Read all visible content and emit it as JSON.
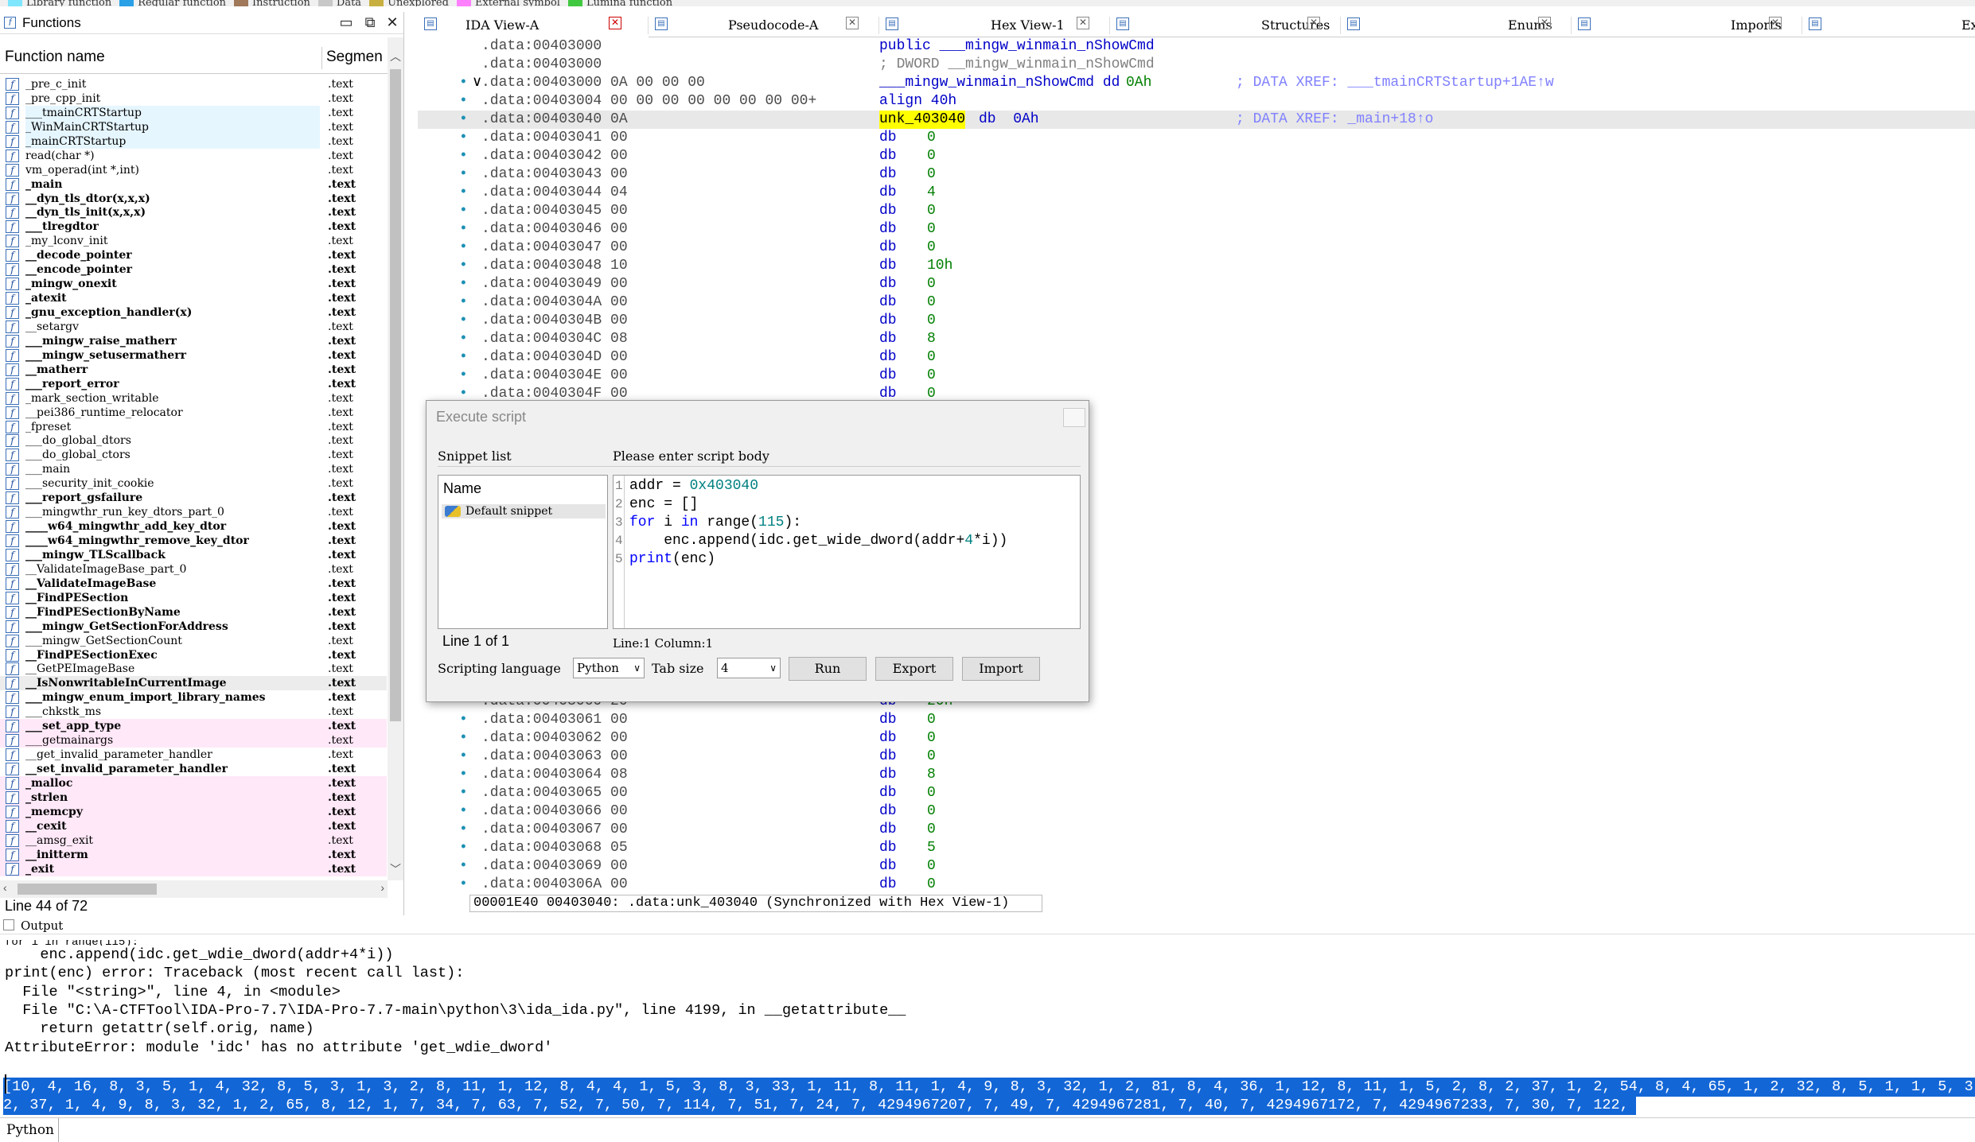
{
  "legend": [
    {
      "label": "Library function",
      "color": "#7fe6ff"
    },
    {
      "label": "Regular function",
      "color": "#2aa0e6"
    },
    {
      "label": "Instruction",
      "color": "#a0785a"
    },
    {
      "label": "Data",
      "color": "#c8c8c8"
    },
    {
      "label": "Unexplored",
      "color": "#c8b040"
    },
    {
      "label": "External symbol",
      "color": "#ff80ff"
    },
    {
      "label": "Lumina function",
      "color": "#40c840"
    }
  ],
  "functions": {
    "title": "Functions",
    "col_name": "Function name",
    "col_segment": "Segmen",
    "status": "Line 44 of 72",
    "rows": [
      {
        "name": "_pre_c_init",
        "seg": ".text",
        "bold": false,
        "lib": false,
        "pink": false
      },
      {
        "name": "_pre_cpp_init",
        "seg": ".text",
        "bold": false,
        "lib": false,
        "pink": false
      },
      {
        "name": "___tmainCRTStartup",
        "seg": ".text",
        "bold": false,
        "lib": true,
        "pink": false
      },
      {
        "name": "_WinMainCRTStartup",
        "seg": ".text",
        "bold": false,
        "lib": true,
        "pink": false
      },
      {
        "name": "_mainCRTStartup",
        "seg": ".text",
        "bold": false,
        "lib": true,
        "pink": false
      },
      {
        "name": "read(char *)",
        "seg": ".text",
        "bold": false,
        "lib": false,
        "pink": false
      },
      {
        "name": "vm_operad(int *,int)",
        "seg": ".text",
        "bold": false,
        "lib": false,
        "pink": false
      },
      {
        "name": "_main",
        "seg": ".text",
        "bold": true,
        "lib": false,
        "pink": false
      },
      {
        "name": "__dyn_tls_dtor(x,x,x)",
        "seg": ".text",
        "bold": true,
        "lib": false,
        "pink": false
      },
      {
        "name": "__dyn_tls_init(x,x,x)",
        "seg": ".text",
        "bold": true,
        "lib": false,
        "pink": false
      },
      {
        "name": "___tlregdtor",
        "seg": ".text",
        "bold": true,
        "lib": false,
        "pink": false
      },
      {
        "name": "_my_lconv_init",
        "seg": ".text",
        "bold": false,
        "lib": false,
        "pink": false
      },
      {
        "name": "__decode_pointer",
        "seg": ".text",
        "bold": true,
        "lib": false,
        "pink": false
      },
      {
        "name": "__encode_pointer",
        "seg": ".text",
        "bold": true,
        "lib": false,
        "pink": false
      },
      {
        "name": "_mingw_onexit",
        "seg": ".text",
        "bold": true,
        "lib": false,
        "pink": false
      },
      {
        "name": "_atexit",
        "seg": ".text",
        "bold": true,
        "lib": false,
        "pink": false
      },
      {
        "name": "_gnu_exception_handler(x)",
        "seg": ".text",
        "bold": true,
        "lib": false,
        "pink": false
      },
      {
        "name": "__setargv",
        "seg": ".text",
        "bold": false,
        "lib": false,
        "pink": false
      },
      {
        "name": "___mingw_raise_matherr",
        "seg": ".text",
        "bold": true,
        "lib": false,
        "pink": false
      },
      {
        "name": "___mingw_setusermatherr",
        "seg": ".text",
        "bold": true,
        "lib": false,
        "pink": false
      },
      {
        "name": "__matherr",
        "seg": ".text",
        "bold": true,
        "lib": false,
        "pink": false
      },
      {
        "name": "___report_error",
        "seg": ".text",
        "bold": true,
        "lib": false,
        "pink": false
      },
      {
        "name": "_mark_section_writable",
        "seg": ".text",
        "bold": false,
        "lib": false,
        "pink": false
      },
      {
        "name": "__pei386_runtime_relocator",
        "seg": ".text",
        "bold": false,
        "lib": false,
        "pink": false
      },
      {
        "name": "_fpreset",
        "seg": ".text",
        "bold": false,
        "lib": false,
        "pink": false
      },
      {
        "name": "___do_global_dtors",
        "seg": ".text",
        "bold": false,
        "lib": false,
        "pink": false
      },
      {
        "name": "___do_global_ctors",
        "seg": ".text",
        "bold": false,
        "lib": false,
        "pink": false
      },
      {
        "name": "___main",
        "seg": ".text",
        "bold": false,
        "lib": false,
        "pink": false
      },
      {
        "name": "___security_init_cookie",
        "seg": ".text",
        "bold": false,
        "lib": false,
        "pink": false
      },
      {
        "name": "___report_gsfailure",
        "seg": ".text",
        "bold": true,
        "lib": false,
        "pink": false
      },
      {
        "name": "___mingwthr_run_key_dtors_part_0",
        "seg": ".text",
        "bold": false,
        "lib": false,
        "pink": false
      },
      {
        "name": "____w64_mingwthr_add_key_dtor",
        "seg": ".text",
        "bold": true,
        "lib": false,
        "pink": false
      },
      {
        "name": "____w64_mingwthr_remove_key_dtor",
        "seg": ".text",
        "bold": true,
        "lib": false,
        "pink": false
      },
      {
        "name": "___mingw_TLScallback",
        "seg": ".text",
        "bold": true,
        "lib": false,
        "pink": false
      },
      {
        "name": "__ValidateImageBase_part_0",
        "seg": ".text",
        "bold": false,
        "lib": false,
        "pink": false
      },
      {
        "name": "__ValidateImageBase",
        "seg": ".text",
        "bold": true,
        "lib": false,
        "pink": false
      },
      {
        "name": "__FindPESection",
        "seg": ".text",
        "bold": true,
        "lib": false,
        "pink": false
      },
      {
        "name": "__FindPESectionByName",
        "seg": ".text",
        "bold": true,
        "lib": false,
        "pink": false
      },
      {
        "name": "___mingw_GetSectionForAddress",
        "seg": ".text",
        "bold": true,
        "lib": false,
        "pink": false
      },
      {
        "name": "___mingw_GetSectionCount",
        "seg": ".text",
        "bold": false,
        "lib": false,
        "pink": false
      },
      {
        "name": "__FindPESectionExec",
        "seg": ".text",
        "bold": true,
        "lib": false,
        "pink": false
      },
      {
        "name": "__GetPEImageBase",
        "seg": ".text",
        "bold": false,
        "lib": false,
        "pink": false
      },
      {
        "name": "__IsNonwritableInCurrentImage",
        "seg": ".text",
        "bold": true,
        "lib": false,
        "pink": false,
        "sel": true
      },
      {
        "name": "___mingw_enum_import_library_names",
        "seg": ".text",
        "bold": true,
        "lib": false,
        "pink": false
      },
      {
        "name": "___chkstk_ms",
        "seg": ".text",
        "bold": false,
        "lib": false,
        "pink": false
      },
      {
        "name": "___set_app_type",
        "seg": ".text",
        "bold": true,
        "lib": false,
        "pink": true
      },
      {
        "name": "___getmainargs",
        "seg": ".text",
        "bold": false,
        "lib": false,
        "pink": true
      },
      {
        "name": "__get_invalid_parameter_handler",
        "seg": ".text",
        "bold": false,
        "lib": false,
        "pink": false
      },
      {
        "name": "__set_invalid_parameter_handler",
        "seg": ".text",
        "bold": true,
        "lib": false,
        "pink": false
      },
      {
        "name": "_malloc",
        "seg": ".text",
        "bold": true,
        "lib": false,
        "pink": true
      },
      {
        "name": "_strlen",
        "seg": ".text",
        "bold": true,
        "lib": false,
        "pink": true
      },
      {
        "name": "_memcpy",
        "seg": ".text",
        "bold": true,
        "lib": false,
        "pink": true
      },
      {
        "name": "__cexit",
        "seg": ".text",
        "bold": true,
        "lib": false,
        "pink": true
      },
      {
        "name": "__amsg_exit",
        "seg": ".text",
        "bold": false,
        "lib": false,
        "pink": true
      },
      {
        "name": "__initterm",
        "seg": ".text",
        "bold": true,
        "lib": false,
        "pink": true
      },
      {
        "name": "_exit",
        "seg": ".text",
        "bold": true,
        "lib": false,
        "pink": true
      }
    ]
  },
  "tabs": [
    {
      "label": "IDA View-A",
      "icon": "ida-icon",
      "active": true
    },
    {
      "label": "Pseudocode-A",
      "icon": "pseudocode-icon",
      "active": false
    },
    {
      "label": "Hex View-1",
      "icon": "hex-icon",
      "active": false
    },
    {
      "label": "Structures",
      "icon": "structures-icon",
      "active": false
    },
    {
      "label": "Enums",
      "icon": "enums-icon",
      "active": false
    },
    {
      "label": "Imports",
      "icon": "imports-icon",
      "active": false
    },
    {
      "label": "Exports",
      "icon": "exports-icon",
      "active": false
    }
  ],
  "disasm_top": [
    {
      "dot": "",
      "addr": ".data:00403000",
      "bytes": "",
      "ins": "public ___mingw_winmain_nShowCmd",
      "opr": "",
      "cmt": "",
      "style": "plain"
    },
    {
      "dot": "",
      "addr": ".data:00403000",
      "bytes": "",
      "ins": "; DWORD __mingw_winmain_nShowCmd",
      "opr": "",
      "cmt": "",
      "style": "grayins"
    },
    {
      "dot": "•",
      "addr": ".data:00403000 0A 00 00 00",
      "bytes": "",
      "ins": "___mingw_winmain_nShowCmd dd ",
      "opr": "0Ah",
      "cmt": "; DATA XREF: ___tmainCRTStartup+1AE↑w",
      "style": "plain"
    },
    {
      "dot": "•",
      "addr": ".data:00403004 00 00 00 00 00 00 00 00+",
      "bytes": "",
      "ins": "align 40h",
      "opr": "",
      "cmt": "",
      "style": "plain"
    },
    {
      "dot": "•",
      "addr": ".data:00403040 0A",
      "bytes": "",
      "ins": "unk_403040",
      "opr": "db  0Ah",
      "cmt": "; DATA XREF: _main+18↑o",
      "style": "label"
    },
    {
      "dot": "•",
      "addr": ".data:00403041 00",
      "bytes": "",
      "ins": "db",
      "opr": "0",
      "cmt": "",
      "style": "db"
    },
    {
      "dot": "•",
      "addr": ".data:00403042 00",
      "bytes": "",
      "ins": "db",
      "opr": "0",
      "cmt": "",
      "style": "db"
    },
    {
      "dot": "•",
      "addr": ".data:00403043 00",
      "bytes": "",
      "ins": "db",
      "opr": "0",
      "cmt": "",
      "style": "db"
    },
    {
      "dot": "•",
      "addr": ".data:00403044 04",
      "bytes": "",
      "ins": "db",
      "opr": "4",
      "cmt": "",
      "style": "db"
    },
    {
      "dot": "•",
      "addr": ".data:00403045 00",
      "bytes": "",
      "ins": "db",
      "opr": "0",
      "cmt": "",
      "style": "db"
    },
    {
      "dot": "•",
      "addr": ".data:00403046 00",
      "bytes": "",
      "ins": "db",
      "opr": "0",
      "cmt": "",
      "style": "db"
    },
    {
      "dot": "•",
      "addr": ".data:00403047 00",
      "bytes": "",
      "ins": "db",
      "opr": "0",
      "cmt": "",
      "style": "db"
    },
    {
      "dot": "•",
      "addr": ".data:00403048 10",
      "bytes": "",
      "ins": "db",
      "opr": "10h",
      "cmt": "",
      "style": "db"
    },
    {
      "dot": "•",
      "addr": ".data:00403049 00",
      "bytes": "",
      "ins": "db",
      "opr": "0",
      "cmt": "",
      "style": "db"
    },
    {
      "dot": "•",
      "addr": ".data:0040304A 00",
      "bytes": "",
      "ins": "db",
      "opr": "0",
      "cmt": "",
      "style": "db"
    },
    {
      "dot": "•",
      "addr": ".data:0040304B 00",
      "bytes": "",
      "ins": "db",
      "opr": "0",
      "cmt": "",
      "style": "db"
    },
    {
      "dot": "•",
      "addr": ".data:0040304C 08",
      "bytes": "",
      "ins": "db",
      "opr": "8",
      "cmt": "",
      "style": "db"
    },
    {
      "dot": "•",
      "addr": ".data:0040304D 00",
      "bytes": "",
      "ins": "db",
      "opr": "0",
      "cmt": "",
      "style": "db"
    },
    {
      "dot": "•",
      "addr": ".data:0040304E 00",
      "bytes": "",
      "ins": "db",
      "opr": "0",
      "cmt": "",
      "style": "db"
    },
    {
      "dot": "•",
      "addr": ".data:0040304F 00",
      "bytes": "",
      "ins": "db",
      "opr": "0",
      "cmt": "",
      "style": "db"
    }
  ],
  "disasm_bottom": [
    {
      "dot": "•",
      "addr": ".data:00403060 20",
      "ins": "db",
      "opr": "20h"
    },
    {
      "dot": "•",
      "addr": ".data:00403061 00",
      "ins": "db",
      "opr": "0"
    },
    {
      "dot": "•",
      "addr": ".data:00403062 00",
      "ins": "db",
      "opr": "0"
    },
    {
      "dot": "•",
      "addr": ".data:00403063 00",
      "ins": "db",
      "opr": "0"
    },
    {
      "dot": "•",
      "addr": ".data:00403064 08",
      "ins": "db",
      "opr": "8"
    },
    {
      "dot": "•",
      "addr": ".data:00403065 00",
      "ins": "db",
      "opr": "0"
    },
    {
      "dot": "•",
      "addr": ".data:00403066 00",
      "ins": "db",
      "opr": "0"
    },
    {
      "dot": "•",
      "addr": ".data:00403067 00",
      "ins": "db",
      "opr": "0"
    },
    {
      "dot": "•",
      "addr": ".data:00403068 05",
      "ins": "db",
      "opr": "5"
    },
    {
      "dot": "•",
      "addr": ".data:00403069 00",
      "ins": "db",
      "opr": "0"
    },
    {
      "dot": "•",
      "addr": ".data:0040306A 00",
      "ins": "db",
      "opr": "0"
    }
  ],
  "hex_status": "00001E40 00403040: .data:unk_403040 (Synchronized with Hex View-1)",
  "dialog": {
    "title": "Execute script",
    "snippet_list_label": "Snippet list",
    "script_body_label": "Please enter script body",
    "snippets_header": "Name",
    "snippet_item": "Default snippet",
    "line_of": "Line 1 of 1",
    "cursor_pos": "Line:1   Column:1",
    "scripting_language_label": "Scripting language",
    "scripting_language": "Python",
    "tab_size_label": "Tab size",
    "tab_size": "4",
    "run": "Run",
    "export": "Export",
    "import": "Import",
    "code": [
      [
        {
          "t": "addr = ",
          "c": ""
        },
        {
          "t": "0x403040",
          "c": "num"
        }
      ],
      [
        {
          "t": "enc = []",
          "c": ""
        }
      ],
      [
        {
          "t": "for",
          "c": "kw"
        },
        {
          "t": " i ",
          "c": ""
        },
        {
          "t": "in",
          "c": "kw"
        },
        {
          "t": " range(",
          "c": ""
        },
        {
          "t": "115",
          "c": "num"
        },
        {
          "t": "):",
          "c": ""
        }
      ],
      [
        {
          "t": "    enc.append(idc.get_wide_dword(addr+",
          "c": ""
        },
        {
          "t": "4",
          "c": "num"
        },
        {
          "t": "*i))",
          "c": ""
        }
      ],
      [
        {
          "t": "print",
          "c": "kw"
        },
        {
          "t": "(enc)",
          "c": ""
        }
      ]
    ]
  },
  "output": {
    "title": "Output",
    "lines": [
      "    enc.append(idc.get_wdie_dword(addr+4*i))",
      "print(enc) error: Traceback (most recent call last):",
      "  File \"<string>\", line 4, in <module>",
      "  File \"C:\\A-CTFTool\\IDA-Pro-7.7\\IDA-Pro-7.7-main\\python\\3\\ida_ida.py\", line 4199, in __getattribute__",
      "    return getattr(self.orig, name)",
      "AttributeError: module 'idc' has no attribute 'get_wdie_dword'"
    ],
    "result_line1": "[10, 4, 16, 8, 3, 5, 1, 4, 32, 8, 5, 3, 1, 3, 2, 8, 11, 1, 12, 8, 4, 4, 1, 5, 3, 8, 3, 33, 1, 11, 8, 11, 1, 4, 9, 8, 3, 32, 1, 2, 81, 8, 4, 36, 1, 12, 8, 11, 1, 5, 2, 8, 2, 37, 1, 2, 54, 8, 4, 65, 1, 2, 32, 8, 5, 1, 1, 5, 3,",
    "result_line2": "2, 37, 1, 4, 9, 8, 3, 32, 1, 2, 65, 8, 12, 1, 7, 34, 7, 63, 7, 52, 7, 50, 7, 114, 7, 51, 7, 24, 7, 4294967207, 7, 49, 7, 4294967281, 7, 40, 7, 4294967172, 7, 4294967233, 7, 30, 7, 122, 0]",
    "interpreter": "Python"
  }
}
